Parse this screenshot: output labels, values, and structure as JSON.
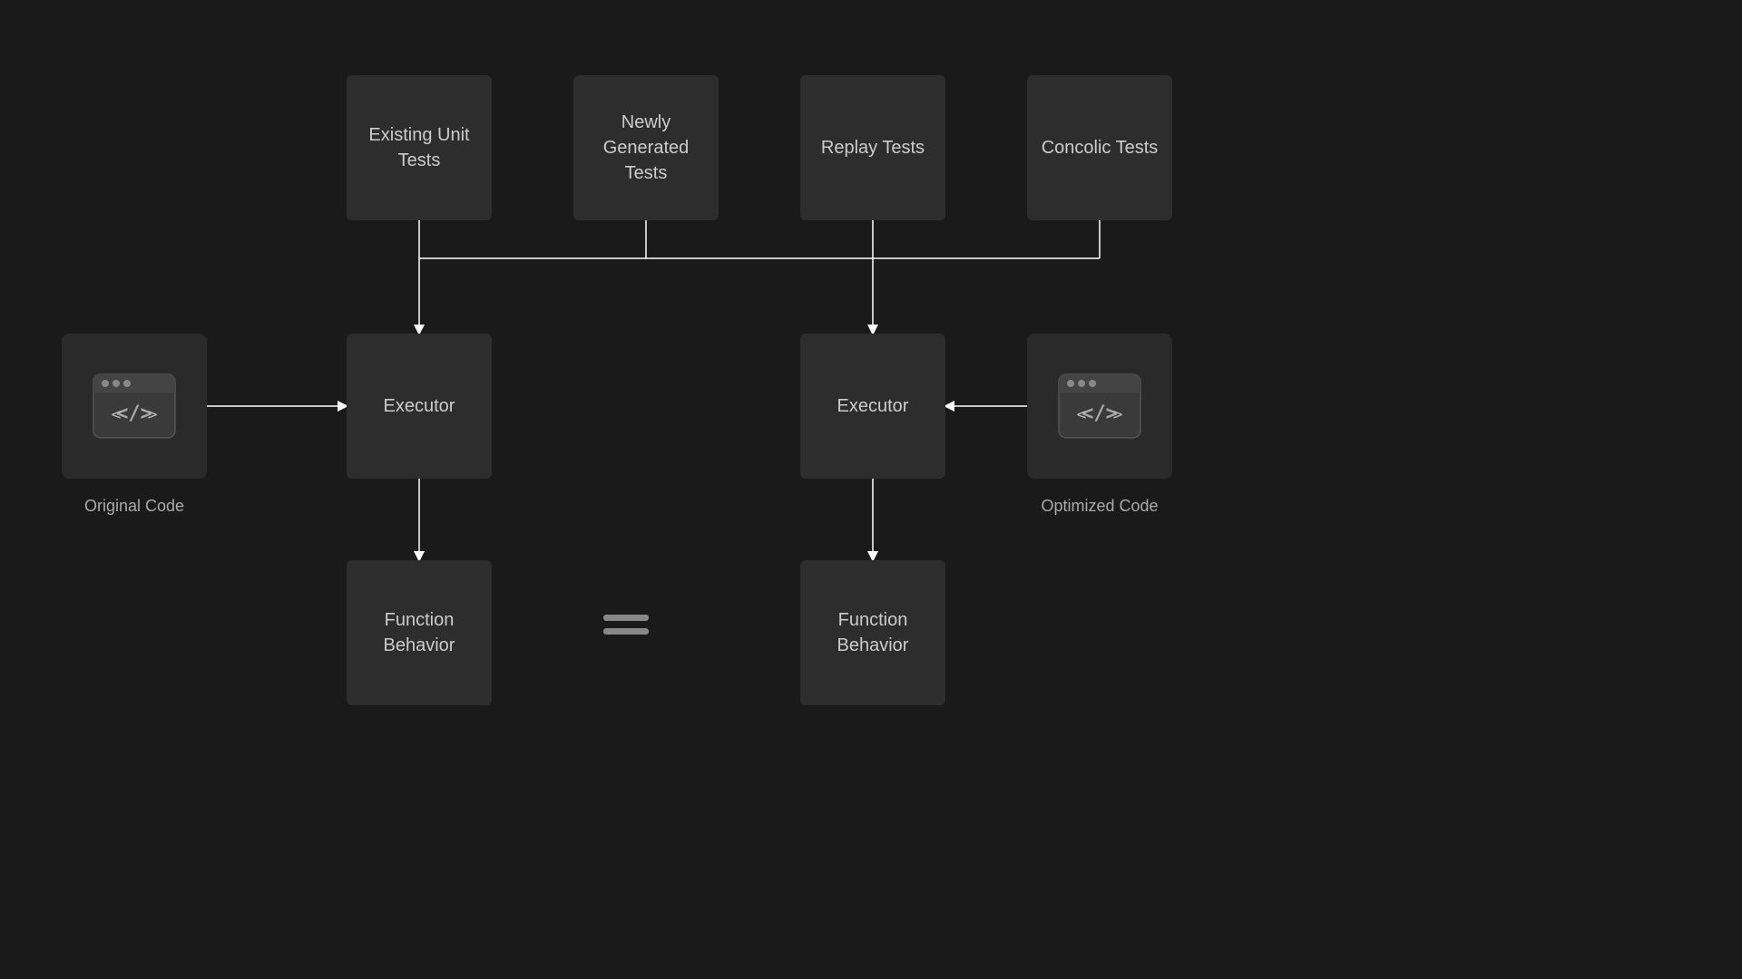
{
  "boxes": {
    "existing_unit_tests": "Existing Unit\nTests",
    "newly_generated_tests": "Newly\nGenerated\nTests",
    "replay_tests": "Replay Tests",
    "concolic_tests": "Concolic Tests",
    "executor_left": "Executor",
    "executor_right": "Executor",
    "function_behavior_left": "Function\nBehavior",
    "function_behavior_right": "Function\nBehavior"
  },
  "labels": {
    "original_code": "Original Code",
    "optimized_code": "Optimized Code"
  }
}
